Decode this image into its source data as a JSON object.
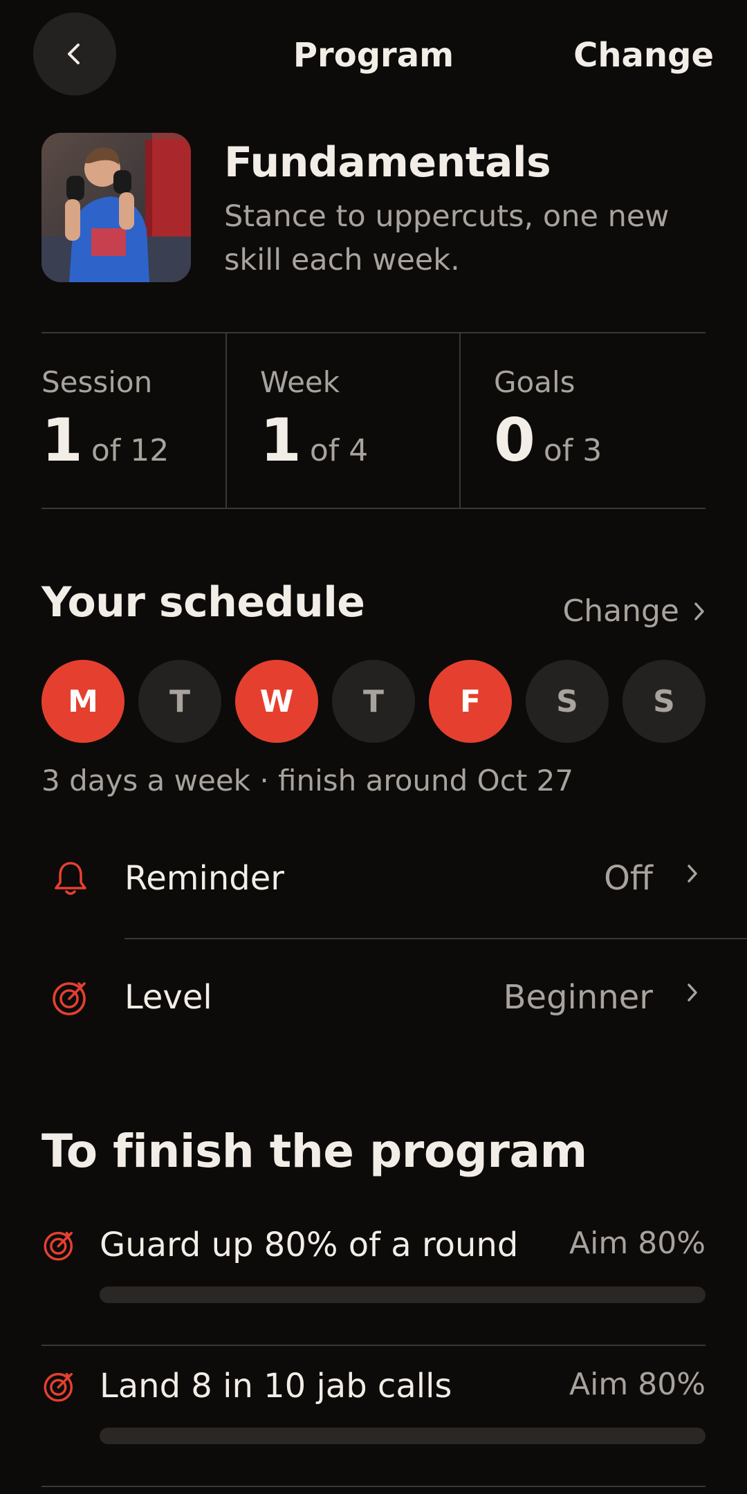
{
  "header": {
    "title": "Program",
    "change_label": "Change"
  },
  "program": {
    "name": "Fundamentals",
    "description": "Stance to uppercuts, one new skill each week."
  },
  "stats": [
    {
      "label": "Session",
      "value": "1",
      "of_text": "of 12"
    },
    {
      "label": "Week",
      "value": "1",
      "of_text": "of 4"
    },
    {
      "label": "Goals",
      "value": "0",
      "of_text": "of 3"
    }
  ],
  "schedule": {
    "title": "Your schedule",
    "change_label": "Change",
    "days": [
      {
        "letter": "M",
        "selected": true
      },
      {
        "letter": "T",
        "selected": false
      },
      {
        "letter": "W",
        "selected": true
      },
      {
        "letter": "T",
        "selected": false
      },
      {
        "letter": "F",
        "selected": true
      },
      {
        "letter": "S",
        "selected": false
      },
      {
        "letter": "S",
        "selected": false
      }
    ],
    "note": "3 days a week · finish around Oct 27"
  },
  "settings": {
    "reminder": {
      "label": "Reminder",
      "value": "Off",
      "icon": "bell-icon"
    },
    "level": {
      "label": "Level",
      "value": "Beginner",
      "icon": "target-icon"
    }
  },
  "goals": {
    "title": "To finish the program",
    "items": [
      {
        "label": "Guard up 80% of a round",
        "aim": "Aim 80%",
        "progress": 0
      },
      {
        "label": "Land 8 in 10 jab calls",
        "aim": "Aim 80%",
        "progress": 0
      }
    ]
  },
  "colors": {
    "accent": "#e5402f",
    "background": "#0c0b0a",
    "surface": "#242221",
    "text_primary": "#f2ede6",
    "text_secondary": "#a9a39d"
  }
}
